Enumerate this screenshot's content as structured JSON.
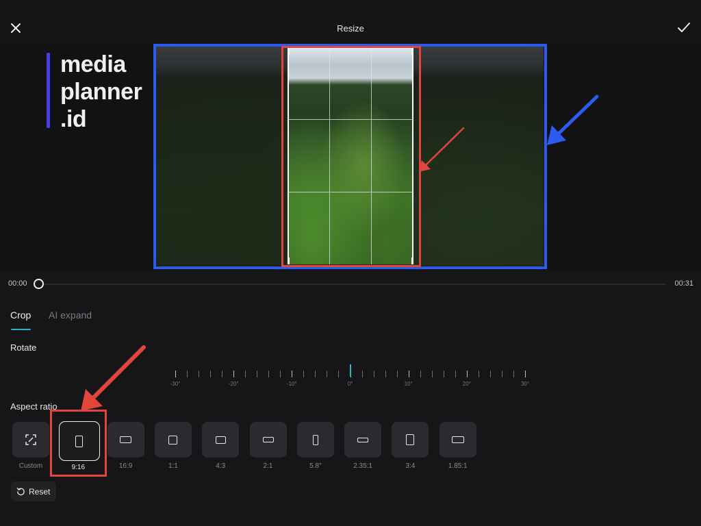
{
  "header": {
    "title": "Resize",
    "close_icon": "close-icon",
    "confirm_icon": "checkmark-icon"
  },
  "watermark": {
    "lines": [
      "media",
      "planner",
      ".id"
    ],
    "accent_color": "#4a3fe0"
  },
  "annotations": {
    "blue_color": "#2d5bef",
    "red_color": "#e2453c"
  },
  "timeline": {
    "current_time": "00:00",
    "total_time": "00:31",
    "progress": 0
  },
  "tabs": [
    {
      "label": "Crop",
      "active": true
    },
    {
      "label": "AI expand",
      "active": false
    }
  ],
  "accent_color": "#27b5c7",
  "rotate": {
    "label": "Rotate",
    "value_degrees": 0,
    "range_degrees": [
      -30,
      30
    ],
    "tick_labels": [
      "-30°",
      "-20°",
      "-10°",
      "0°",
      "10°",
      "20°",
      "30°"
    ]
  },
  "aspect_ratio": {
    "label": "Aspect ratio",
    "selected": "9:16",
    "options": [
      {
        "label": "Custom",
        "icon": "custom-crop-icon"
      },
      {
        "label": "9:16",
        "icon": "portrait-9-16-icon"
      },
      {
        "label": "16:9",
        "icon": "landscape-16-9-icon"
      },
      {
        "label": "1:1",
        "icon": "square-1-1-icon"
      },
      {
        "label": "4:3",
        "icon": "landscape-4-3-icon"
      },
      {
        "label": "2:1",
        "icon": "landscape-2-1-icon"
      },
      {
        "label": "5.8\"",
        "icon": "portrait-5-8-icon"
      },
      {
        "label": "2.35:1",
        "icon": "landscape-2-35-1-icon"
      },
      {
        "label": "3:4",
        "icon": "portrait-3-4-icon"
      },
      {
        "label": "1.85:1",
        "icon": "landscape-1-85-1-icon"
      }
    ]
  },
  "reset": {
    "label": "Reset",
    "icon": "reset-icon"
  }
}
